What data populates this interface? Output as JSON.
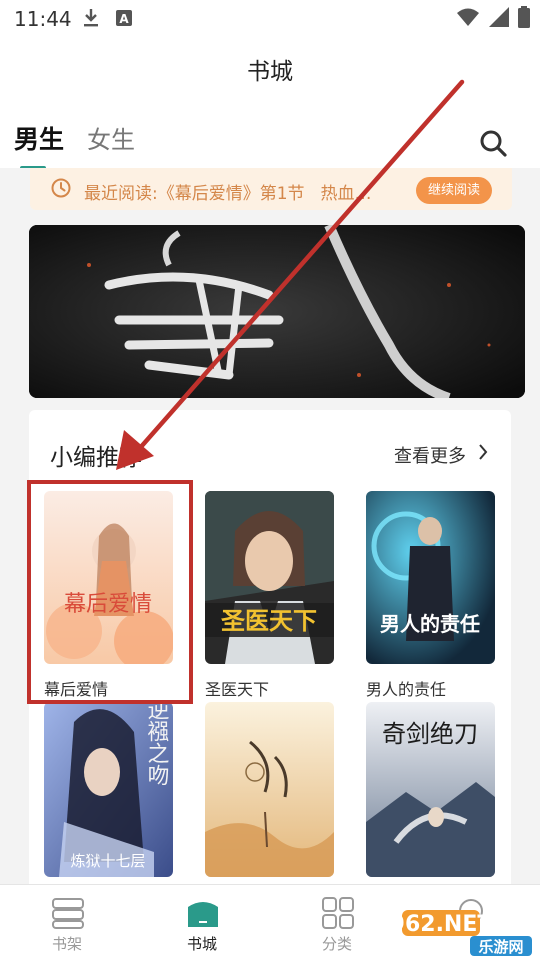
{
  "status": {
    "time": "11:44"
  },
  "header": {
    "title": "书城"
  },
  "tabs": [
    {
      "label": "男生"
    },
    {
      "label": "女生"
    }
  ],
  "recent_reading": {
    "text": "最近阅读:《幕后爱情》第1节",
    "extra": "热血…",
    "button": "继续阅读"
  },
  "section": {
    "title": "小编推荐",
    "more": "查看更多"
  },
  "books": [
    {
      "name": "幕后爱情",
      "cover_title": "幕后爱情"
    },
    {
      "name": "圣医天下",
      "cover_title": "圣医天下"
    },
    {
      "name": "男人的责任",
      "cover_title": "男人的责任"
    },
    {
      "name": "",
      "cover_title": "逆襁之吻"
    },
    {
      "name": "",
      "cover_title": ""
    },
    {
      "name": "",
      "cover_title": "奇剑绝刀"
    }
  ],
  "nav": [
    {
      "label": "书架",
      "icon": "bookshelf-icon"
    },
    {
      "label": "书城",
      "icon": "bookstore-icon",
      "active": true
    },
    {
      "label": "分类",
      "icon": "category-icon"
    },
    {
      "label": "",
      "icon": "profile-icon"
    }
  ],
  "watermark": {
    "text": "962.NET",
    "sub": "乐游网"
  },
  "colors": {
    "accent": "#2a9a8a",
    "orange": "#f3944a",
    "annotation_red": "#c0312c"
  }
}
